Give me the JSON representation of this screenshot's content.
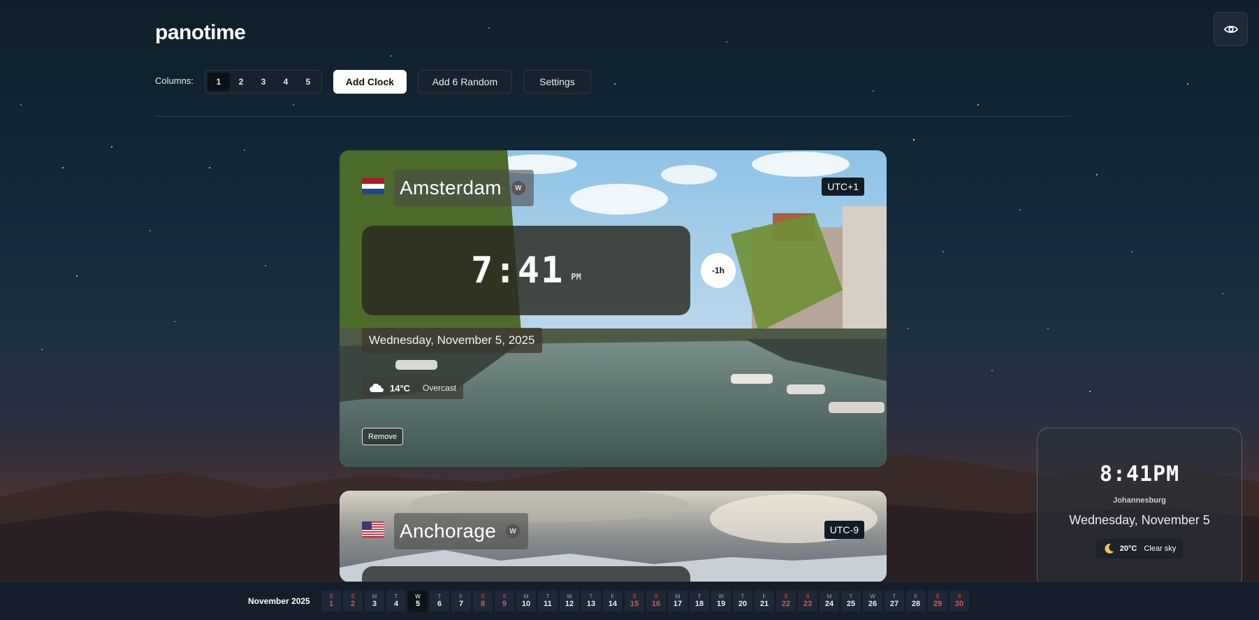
{
  "app": {
    "title": "panotime"
  },
  "header": {
    "visibility_icon": "eye-icon"
  },
  "toolbar": {
    "columns_label": "Columns:",
    "columns": [
      "1",
      "2",
      "3",
      "4",
      "5"
    ],
    "active_column": "1",
    "add_clock": "Add Clock",
    "add_random": "Add 6 Random",
    "settings": "Settings"
  },
  "clocks": [
    {
      "city": "Amsterdam",
      "wiki_label": "W",
      "flag": "netherlands-flag",
      "utc": "UTC+1",
      "time": "7:41",
      "ampm": "PM",
      "diff": "-1h",
      "date": "Wednesday, November 5, 2025",
      "weather_icon": "cloud-icon",
      "temp": "14°C",
      "condition": "Overcast",
      "remove_label": "Remove"
    },
    {
      "city": "Anchorage",
      "wiki_label": "W",
      "flag": "usa-flag",
      "utc": "UTC-9"
    }
  ],
  "local_clock": {
    "time": "8:41PM",
    "city": "Johannesburg",
    "date": "Wednesday, November 5",
    "weather_icon": "moon-icon",
    "temp": "20°C",
    "condition": "Clear sky"
  },
  "calendar": {
    "month": "November 2025",
    "today": "5",
    "days": [
      {
        "w": "S",
        "n": "1",
        "weekend": true
      },
      {
        "w": "S",
        "n": "2",
        "weekend": true
      },
      {
        "w": "M",
        "n": "3"
      },
      {
        "w": "T",
        "n": "4"
      },
      {
        "w": "W",
        "n": "5"
      },
      {
        "w": "T",
        "n": "6"
      },
      {
        "w": "F",
        "n": "7"
      },
      {
        "w": "S",
        "n": "8",
        "weekend": true
      },
      {
        "w": "S",
        "n": "9",
        "weekend": true
      },
      {
        "w": "M",
        "n": "10"
      },
      {
        "w": "T",
        "n": "11"
      },
      {
        "w": "W",
        "n": "12"
      },
      {
        "w": "T",
        "n": "13"
      },
      {
        "w": "F",
        "n": "14"
      },
      {
        "w": "S",
        "n": "15",
        "weekend": true
      },
      {
        "w": "S",
        "n": "16",
        "weekend": true
      },
      {
        "w": "M",
        "n": "17"
      },
      {
        "w": "T",
        "n": "18"
      },
      {
        "w": "W",
        "n": "19"
      },
      {
        "w": "T",
        "n": "20"
      },
      {
        "w": "F",
        "n": "21"
      },
      {
        "w": "S",
        "n": "22",
        "weekend": true
      },
      {
        "w": "S",
        "n": "23",
        "weekend": true
      },
      {
        "w": "M",
        "n": "24"
      },
      {
        "w": "T",
        "n": "25"
      },
      {
        "w": "W",
        "n": "26"
      },
      {
        "w": "T",
        "n": "27"
      },
      {
        "w": "F",
        "n": "28"
      },
      {
        "w": "S",
        "n": "29",
        "weekend": true
      },
      {
        "w": "S",
        "n": "30",
        "weekend": true
      }
    ]
  }
}
